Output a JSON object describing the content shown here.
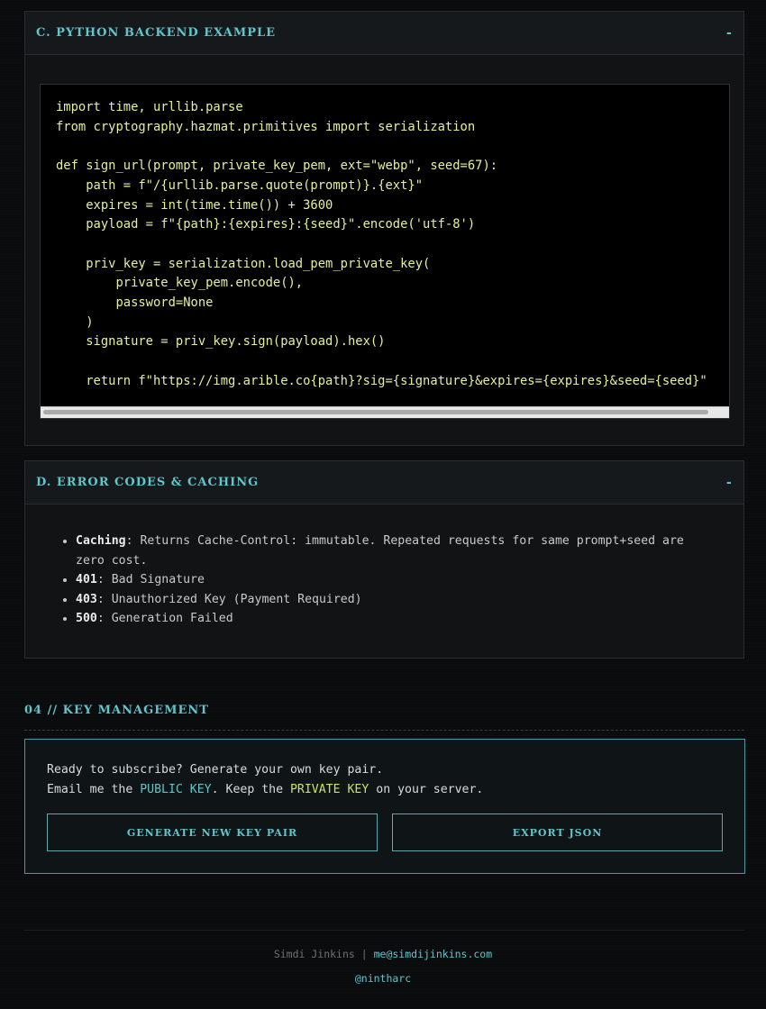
{
  "python_panel": {
    "title": "C. PYTHON BACKEND EXAMPLE",
    "toggle": "-",
    "code": "import time, urllib.parse\nfrom cryptography.hazmat.primitives import serialization\n\ndef sign_url(prompt, private_key_pem, ext=\"webp\", seed=67):\n    path = f\"/{urllib.parse.quote(prompt)}.{ext}\"\n    expires = int(time.time()) + 3600\n    payload = f\"{path}:{expires}:{seed}\".encode('utf-8')\n\n    priv_key = serialization.load_pem_private_key(\n        private_key_pem.encode(),\n        password=None\n    )\n    signature = priv_key.sign(payload).hex()\n\n    return f\"https://img.arible.co{path}?sig={signature}&expires={expires}&seed={seed}\""
  },
  "errors_panel": {
    "title": "D. ERROR CODES & CACHING",
    "toggle": "-",
    "items": [
      {
        "label": "Caching",
        "text": ": Returns Cache-Control: immutable. Repeated requests for same prompt+seed are zero cost."
      },
      {
        "label": "401",
        "text": ": Bad Signature"
      },
      {
        "label": "403",
        "text": ": Unauthorized Key (Payment Required)"
      },
      {
        "label": "500",
        "text": ": Generation Failed"
      }
    ]
  },
  "key_management": {
    "section_title": "04 // KEY MANAGEMENT",
    "line1": "Ready to subscribe? Generate your own key pair.",
    "line2_a": "Email me the ",
    "public_key": "PUBLIC KEY",
    "line2_b": ". Keep the ",
    "private_key": "PRIVATE KEY",
    "line2_c": " on your server.",
    "generate_label": "GENERATE NEW KEY PAIR",
    "export_label": "EXPORT JSON"
  },
  "footer": {
    "name": "Simdi Jinkins",
    "separator": " | ",
    "email": "me@simdijinkins.com",
    "handle": "@nintharc"
  }
}
